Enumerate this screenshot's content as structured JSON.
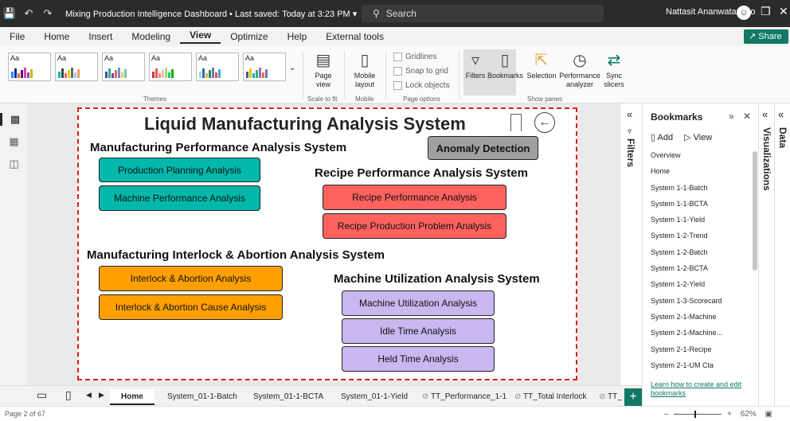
{
  "titlebar": {
    "title": "Mixing Production Intelligence Dashboard • Last saved: Today at 3:23 PM ▾",
    "search": "Search",
    "user": "Nattasit Ananwatanyoo"
  },
  "menu": [
    "File",
    "Home",
    "Insert",
    "Modeling",
    "View",
    "Optimize",
    "Help",
    "External tools"
  ],
  "share_label": "Share",
  "ribbon": {
    "themes_label": "Themes",
    "page_view": "Page view",
    "scale_to_fit": "Scale to fit",
    "mobile_layout": "Mobile layout",
    "mobile": "Mobile",
    "gridlines": "Gridlines",
    "snap_to_grid": "Snap to grid",
    "lock_objects": "Lock objects",
    "page_options": "Page options",
    "filters": "Filters",
    "bookmarks": "Bookmarks",
    "selection": "Selection",
    "performance_analyzer": "Performance analyzer",
    "sync_slicers": "Sync slicers",
    "show_panes": "Show panes"
  },
  "report": {
    "title": "Liquid Manufacturing Analysis System",
    "sections": {
      "manufacturing_performance": "Manufacturing Performance Analysis System",
      "recipe_performance": "Recipe Performance Analysis System",
      "interlock": "Manufacturing Interlock & Abortion Analysis System",
      "machine_utilization": "Machine Utilization Analysis System"
    },
    "buttons": {
      "anomaly_detection": "Anomaly Detection",
      "production_planning": "Production Planning Analysis",
      "machine_performance": "Machine Performance Analysis",
      "recipe_performance": "Recipe Performance Analysis",
      "recipe_production_problem": "Recipe Production Problem Analysis",
      "interlock_abortion": "Interlock & Abortion Analysis",
      "interlock_abortion_cause": "Interlock & Abortion Cause Analysis",
      "machine_utilization": "Machine Utilization Analysis",
      "idle_time": "Idle Time Analysis",
      "held_time": "Held Time Analysis"
    }
  },
  "panes": {
    "filters": "Filters",
    "bookmarks_title": "Bookmarks",
    "add": "Add",
    "view": "View",
    "bookmark_items": [
      "Overview",
      "Home",
      "System 1-1-Batch",
      "System 1-1-BCTA",
      "System 1-1-Yield",
      "System 1-2-Trend",
      "System 1-2-Batch",
      "System 1-2-BCTA",
      "System 1-2-Yield",
      "System 1-3-Scorecard",
      "System 2-1-Machine",
      "System 2-1-Machine...",
      "System 2-1-Recipe",
      "System 2-1-UM Cta"
    ],
    "learn_link": "Learn how to create and edit bookmarks",
    "visualizations": "Visualizations",
    "data": "Data"
  },
  "tabs": {
    "home": "Home",
    "t1": "System_01-1-Batch",
    "t2": "System_01-1-BCTA",
    "t3": "System_01-1-Yield",
    "t4": "TT_Performance_1-1",
    "t5": "TT_Total Interlock",
    "t6": "TT_"
  },
  "status": {
    "page": "Page 2 of 67",
    "zoom": "62%"
  },
  "colors": {
    "teal": "#01b8aa",
    "red": "#fd625e",
    "orange": "#ffa000",
    "purple": "#c9b7ef",
    "grey": "#a0a0a0",
    "accent": "#117865"
  }
}
